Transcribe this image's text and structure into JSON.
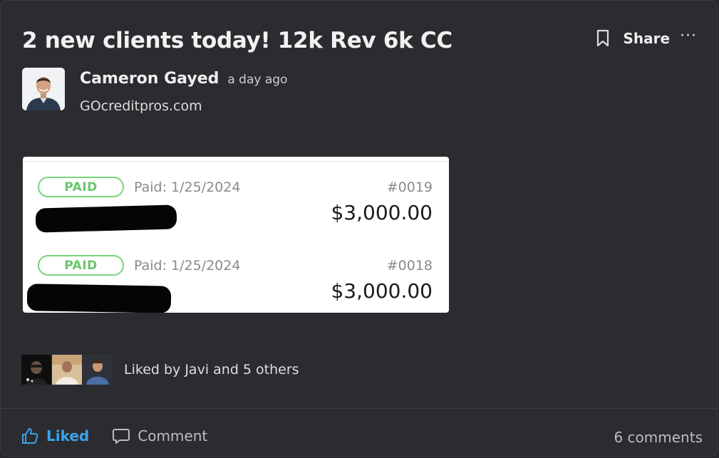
{
  "post": {
    "title": "2 new clients today! 12k Rev 6k CC",
    "author": "Cameron Gayed",
    "time": "a day ago",
    "subtitle": "GOcreditpros.com"
  },
  "actions_top": {
    "share_label": "Share",
    "more_label": "···"
  },
  "invoice": {
    "rows": [
      {
        "status": "PAID",
        "date": "Paid: 1/25/2024",
        "number": "#0019",
        "amount": "$3,000.00"
      },
      {
        "status": "PAID",
        "date": "Paid: 1/25/2024",
        "number": "#0018",
        "amount": "$3,000.00"
      }
    ]
  },
  "likes": {
    "text": "Liked by Javi and 5 others"
  },
  "footer": {
    "liked_label": "Liked",
    "comment_label": "Comment",
    "comments_count": "6 comments"
  },
  "colors": {
    "accent": "#3ba3e8",
    "paid_green": "#6cc46c",
    "background": "#2b2c30"
  }
}
